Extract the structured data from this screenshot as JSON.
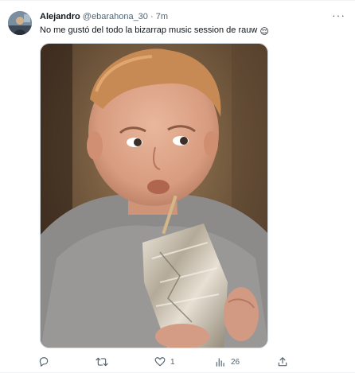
{
  "tweet": {
    "author": {
      "name": "Alejandro",
      "handle": "@ebarahona_30",
      "separator": "·",
      "time": "7m"
    },
    "text": "No me gustó del todo la bizarrap music session de rauw",
    "text_emoji": "😌",
    "more_label": "···",
    "media": {
      "icon": "photo-child-drinking-juice-pouch"
    },
    "actions": {
      "reply": {
        "icon": "reply-icon",
        "count": ""
      },
      "retweet": {
        "icon": "retweet-icon",
        "count": ""
      },
      "like": {
        "icon": "heart-icon",
        "count": "1"
      },
      "views": {
        "icon": "views-icon",
        "count": "26"
      },
      "share": {
        "icon": "share-icon",
        "count": ""
      }
    }
  },
  "colors": {
    "primary_text": "#0f1419",
    "secondary_text": "#536471",
    "border": "#cfd9de"
  }
}
